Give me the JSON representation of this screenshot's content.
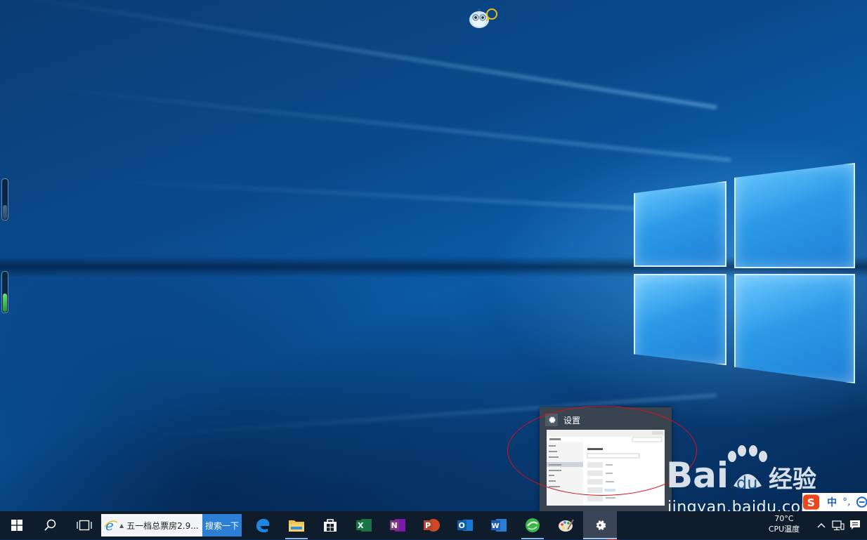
{
  "taskbar": {
    "start_icon": "windows-start-icon",
    "search_icon": "search-icon",
    "task_view_icon": "task-view-icon",
    "ie_search_text": "五一档总票房2.9...",
    "search_button_label": "搜索一下",
    "pinned_apps": [
      {
        "name": "edge-icon"
      },
      {
        "name": "file-explorer-icon"
      },
      {
        "name": "store-icon"
      },
      {
        "name": "excel-icon"
      },
      {
        "name": "onenote-icon"
      },
      {
        "name": "powerpoint-icon"
      },
      {
        "name": "outlook-icon"
      },
      {
        "name": "word-icon"
      },
      {
        "name": "browser-360-icon"
      },
      {
        "name": "paint-icon"
      },
      {
        "name": "settings-gear-icon"
      }
    ]
  },
  "tray": {
    "temperature": "70°C",
    "temperature_label": "CPU温度"
  },
  "preview": {
    "title": "设置"
  },
  "ime": {
    "mode": "中"
  },
  "watermark": {
    "brand": "Baidu经验",
    "url": "jingyan.baidu.com"
  },
  "colors": {
    "taskbar": "#0f1c2c",
    "accent": "#2d7fd6",
    "annotation_red": "#d6121b"
  }
}
